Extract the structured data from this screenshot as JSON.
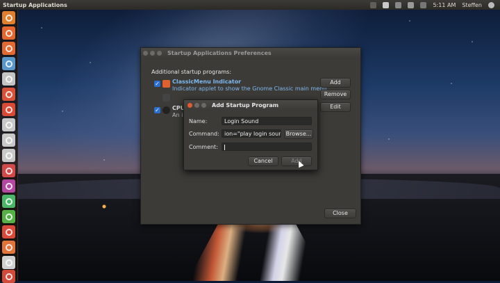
{
  "panel": {
    "title": "Startup Applications",
    "time": "5:11 AM",
    "user": "Steffen"
  },
  "launcher": {
    "icons": [
      "dash-home",
      "files",
      "browser",
      "startup-app",
      "settings",
      "update-manager",
      "app-7",
      "app-8",
      "app-9",
      "app-10",
      "app-11",
      "app-12",
      "terminal",
      "app-14",
      "monitor",
      "app-16",
      "app-17",
      "trash"
    ]
  },
  "main": {
    "title": "Startup Applications Preferences",
    "section_label": "Additional startup programs:",
    "items": [
      {
        "name": "ClassicMenu Indicator",
        "desc": "Indicator applet to show the Gnome Classic main menu",
        "checked": true
      },
      {
        "name": "",
        "desc": "",
        "checked": false
      },
      {
        "name": "CPU",
        "desc": "An in",
        "checked": true
      }
    ],
    "add_label": "Add",
    "remove_label": "Remove",
    "edit_label": "Edit",
    "close_label": "Close"
  },
  "dialog": {
    "title": "Add Startup Program",
    "name_label": "Name:",
    "name_value": "Login Sound",
    "command_label": "Command:",
    "command_value": "ion=\"play login sound\"",
    "browse_label": "Browse...",
    "comment_label": "Comment:",
    "comment_value": "",
    "cancel_label": "Cancel",
    "add_label": "Add"
  }
}
